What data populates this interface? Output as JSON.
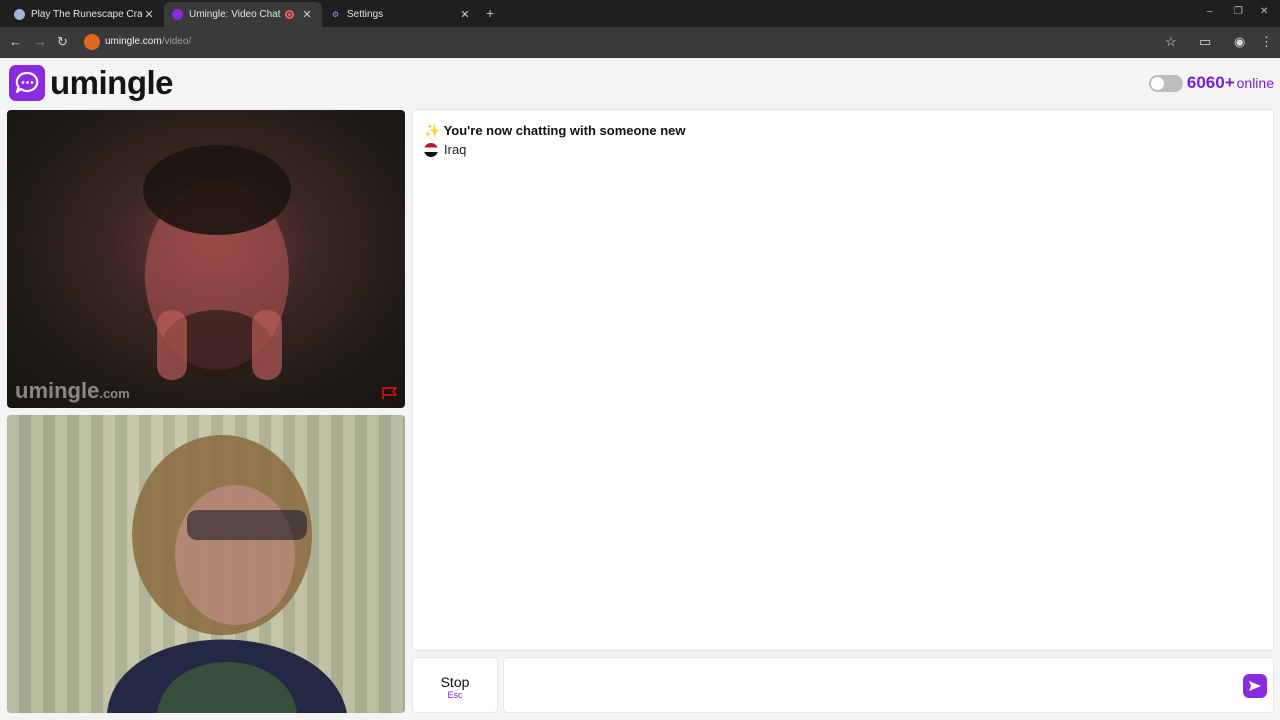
{
  "browser": {
    "tabs": [
      {
        "title": "Play The Runescape Cras",
        "icon": "runescape-icon",
        "active": false
      },
      {
        "title": "Umingle: Video Chat",
        "icon": "umingle-icon",
        "active": true,
        "recording": true
      },
      {
        "title": "Settings",
        "icon": "gear-icon",
        "active": false
      }
    ],
    "url_host": "umingle.com",
    "url_path": "/video/"
  },
  "header": {
    "logo_text": "umingle",
    "online_count": "6060+",
    "online_label": "online"
  },
  "video": {
    "watermark": "umingle",
    "watermark_domain": ".com"
  },
  "chat": {
    "status_icon": "✨",
    "status": "You're now chatting with someone new",
    "country": "Iraq"
  },
  "controls": {
    "stop_label": "Stop",
    "stop_key": "Esc",
    "message_placeholder": ""
  },
  "colors": {
    "brand": "#8a2be2",
    "online_text": "#7b1fd6"
  }
}
